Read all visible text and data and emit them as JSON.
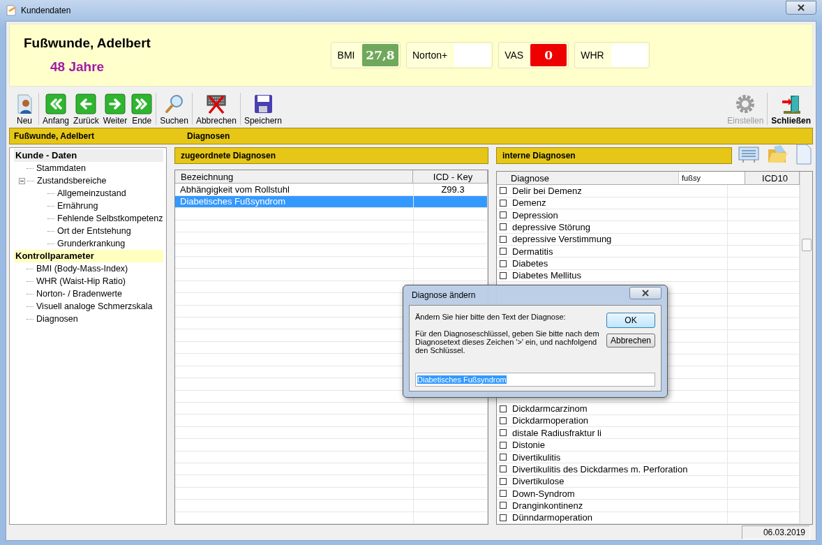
{
  "window": {
    "title": "Kundendaten"
  },
  "patient": {
    "name": "Fußwunde, Adelbert",
    "age": "48 Jahre"
  },
  "metrics": [
    {
      "label": "BMI",
      "value": "27,8",
      "color": "#6fa85a"
    },
    {
      "label": "Norton+",
      "color": "#ffffff"
    },
    {
      "label": "VAS",
      "value": "0",
      "color": "#ee0000"
    },
    {
      "label": "WHR",
      "color": "#ffffff"
    }
  ],
  "toolbar": {
    "left": [
      {
        "label": "Neu",
        "disabled": false
      },
      {
        "label": "Anfang",
        "disabled": false
      },
      {
        "label": "Zurück",
        "disabled": false
      },
      {
        "label": "Weiter",
        "disabled": false
      },
      {
        "label": "Ende",
        "disabled": false
      },
      {
        "label": "Suchen",
        "disabled": false
      },
      {
        "label": "Abbrechen",
        "disabled": false
      },
      {
        "label": "Speichern",
        "disabled": false
      }
    ],
    "right": [
      {
        "label": "Einstellen",
        "disabled": true
      },
      {
        "label": "Schließen",
        "disabled": false
      }
    ]
  },
  "context_bar": {
    "patient": "Fußwunde,  Adelbert",
    "section": "Diagnosen"
  },
  "tree": [
    {
      "label": "Kunde - Daten",
      "selected": false,
      "children": [
        {
          "label": "Stammdaten"
        },
        {
          "label": "Zustandsbereiche",
          "expanded": true,
          "children": [
            {
              "label": "Allgemeinzustand"
            },
            {
              "label": "Ernährung"
            },
            {
              "label": "Fehlende Selbstkompetenz"
            },
            {
              "label": "Ort der Entstehung"
            },
            {
              "label": "Grunderkrankung"
            }
          ]
        }
      ]
    },
    {
      "label": "Kontrollparameter",
      "selected": true,
      "children": [
        {
          "label": "BMI (Body-Mass-Index)"
        },
        {
          "label": "WHR (Waist-Hip Ratio)"
        },
        {
          "label": "Norton- / Bradenwerte"
        },
        {
          "label": "Visuell analoge Schmerzskala"
        },
        {
          "label": "Diagnosen"
        }
      ]
    }
  ],
  "assigned": {
    "title": "zugeordnete Diagnosen",
    "columns": [
      "Bezeichnung",
      "ICD - Key"
    ],
    "rows": [
      {
        "name": "Abhängigkeit vom Rollstuhl",
        "key": "Z99.3",
        "selected": false
      },
      {
        "name": "Diabetisches Fußsyndrom",
        "selected": true
      }
    ]
  },
  "internal": {
    "title": "interne Diagnosen",
    "columns": [
      "Diagnose",
      "ICD10"
    ],
    "filter": "fußsy",
    "rows": [
      {
        "label": "Delir bei Demenz",
        "checked": false
      },
      {
        "label": "Demenz",
        "checked": false
      },
      {
        "label": "Depression",
        "checked": false
      },
      {
        "label": "depressive Störung",
        "checked": false
      },
      {
        "label": "depressive Verstimmung",
        "checked": false
      },
      {
        "label": "Dermatitis",
        "checked": false
      },
      {
        "label": "Diabetes",
        "checked": false
      },
      {
        "label": "Diabetes Mellitus",
        "checked": false
      }
    ],
    "rows_below_dialog": [
      {
        "label": "Dickdarmcarzinom",
        "checked": false
      },
      {
        "label": "Dickdarmoperation",
        "checked": false
      },
      {
        "label": "distale Radiusfraktur li",
        "checked": false
      },
      {
        "label": "Distonie",
        "checked": false
      },
      {
        "label": "Divertikulitis",
        "checked": false
      },
      {
        "label": "Divertikulitis des Dickdarmes m. Perforation",
        "checked": false
      },
      {
        "label": "Divertikulose",
        "checked": false
      },
      {
        "label": "Down-Syndrom",
        "checked": false
      },
      {
        "label": "Dranginkontinenz",
        "checked": false
      },
      {
        "label": "Dünndarmoperation",
        "checked": false
      }
    ]
  },
  "dialog": {
    "title": "Diagnose ändern",
    "prompt": "Ändern Sie hier bitte den Text der Diagnose:",
    "hint": "Für den Diagnoseschlüssel, geben Sie bitte nach dem Diagnosetext dieses Zeichen '>' ein, und nachfolgend den Schlüssel.",
    "value": "Diabetisches Fußsyndrom",
    "buttons": [
      {
        "label": "OK",
        "default": true
      },
      {
        "label": "Abbrechen",
        "default": false
      }
    ]
  },
  "status_bar": {
    "date": "06.03.2019"
  }
}
